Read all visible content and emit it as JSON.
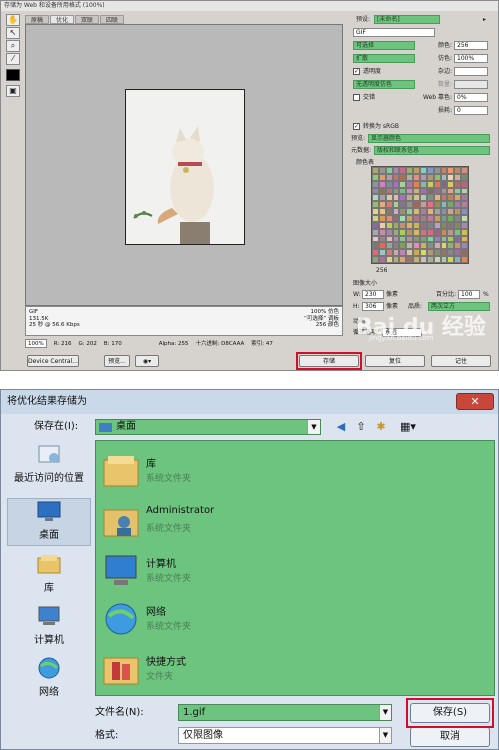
{
  "sfw": {
    "title": "存储为 Web 和设备所用格式 (100%)",
    "tabs": [
      "原稿",
      "优化",
      "双联",
      "四联"
    ],
    "info_left": [
      "GIF",
      "131.5K",
      "25 秒 @ 56.6 Kbps"
    ],
    "info_right": [
      "100% 仿色",
      "“可选择” 调板",
      "256 颜色"
    ],
    "status": {
      "zoom": "100%",
      "r": "R: 216",
      "g": "G: 202",
      "b": "B: 170",
      "alpha": "Alpha: 255",
      "hex": "十六进制: D8CAAA",
      "index": "索引: 47"
    },
    "buttons": {
      "device_central": "Device Central...",
      "preview": "预览...",
      "save": "存储",
      "reset": "复位",
      "remember": "记住"
    },
    "panel": {
      "preset_label": "预设:",
      "preset_value": "[未命名]",
      "format": "GIF",
      "reduction": "可选择",
      "colors_label": "颜色:",
      "colors_value": "256",
      "dither_algo": "扩散",
      "dither_label": "仿色:",
      "dither_value": "100%",
      "transparency": "透明度",
      "matte_label": "杂边:",
      "trans_dither": "无透明度仿色",
      "amount_label": "数量:",
      "interlaced": "交错",
      "web_snap_label": "Web 靠色:",
      "web_snap_value": "0%",
      "lossy_label": "损耗:",
      "lossy_value": "0",
      "convert_srgb": "转换为 sRGB",
      "preview_label": "预览:",
      "preview_value": "显示器颜色",
      "metadata_label": "元数据:",
      "metadata_value": "版权和联系信息",
      "color_table": "颜色表",
      "color_count": "256",
      "image_size": "图像大小",
      "w_label": "W:",
      "w_value": "230",
      "h_label": "H:",
      "h_value": "306",
      "px_unit": "像素",
      "percent_label": "百分比:",
      "percent_value": "100",
      "percent_unit": "%",
      "quality_label": "品质:",
      "quality_value": "两次立方",
      "anim_label": "动画",
      "loop_label": "循环选项:",
      "loop_value": "永远"
    },
    "watermark": "Bai du 经验",
    "watermark_url": "jingyan.baidu.com"
  },
  "dialog": {
    "title": "将优化结果存储为",
    "close": "✕",
    "save_in_label": "保存在(I):",
    "save_in_value": "桌面",
    "places": [
      "最近访问的位置",
      "桌面",
      "库",
      "计算机",
      "网络"
    ],
    "files": [
      {
        "name": "库",
        "type": "系统文件夹"
      },
      {
        "name": "Administrator",
        "type": "系统文件夹"
      },
      {
        "name": "计算机",
        "type": "系统文件夹"
      },
      {
        "name": "网络",
        "type": "系统文件夹"
      },
      {
        "name": "快捷方式",
        "type": "文件夹"
      }
    ],
    "filename_label": "文件名(N):",
    "filename_value": "1.gif",
    "format_label": "格式:",
    "format_value": "仅限图像",
    "save_button": "保存(S)",
    "cancel_button": "取消"
  },
  "colors": {
    "highlight_green": "#6cc47e",
    "red_frame": "#d0102a"
  }
}
